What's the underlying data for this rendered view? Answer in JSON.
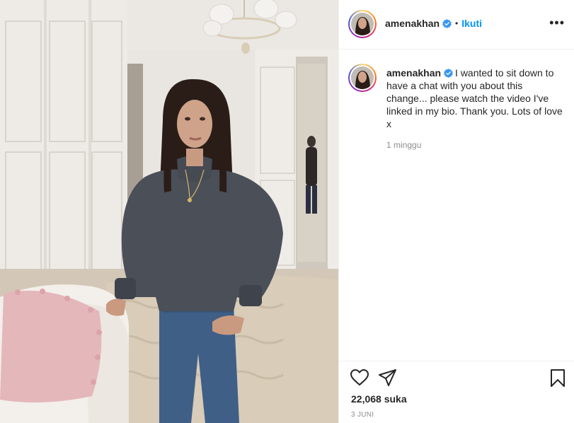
{
  "post": {
    "username": "amenakhan",
    "follow_label": "Ikuti",
    "separator": "•",
    "more_label": "•••",
    "caption_text": "I wanted to sit down to have a chat with you about this change... please watch the video I've linked in my bio. Thank you. Lots of love x",
    "time_ago": "1 minggu",
    "likes": "22,068 suka",
    "date": "3 JUNI"
  },
  "icons": {
    "verified": "verified-badge-icon",
    "like": "heart-icon",
    "share": "paper-plane-icon",
    "save": "bookmark-icon",
    "more": "ellipsis-icon"
  },
  "colors": {
    "link_blue": "#0095f6",
    "text": "#262626",
    "secondary_text": "#8e8e8e",
    "divider": "#efefef"
  }
}
